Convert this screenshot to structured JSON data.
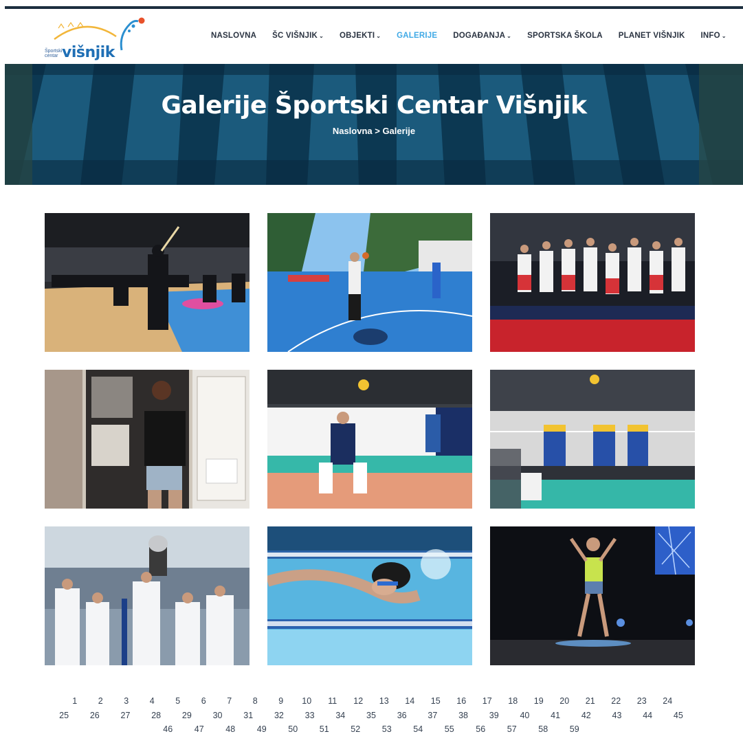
{
  "header": {
    "logo": {
      "small_text": "Športski centar",
      "name": "višnjik"
    },
    "nav": [
      {
        "label": "NASLOVNA",
        "dropdown": false,
        "active": false
      },
      {
        "label": "ŠC VIŠNJIK",
        "dropdown": true,
        "active": false
      },
      {
        "label": "OBJEKTI",
        "dropdown": true,
        "active": false
      },
      {
        "label": "GALERIJE",
        "dropdown": false,
        "active": true
      },
      {
        "label": "DOGAĐANJA",
        "dropdown": true,
        "active": false
      },
      {
        "label": "SPORTSKA ŠKOLA",
        "dropdown": false,
        "active": false
      },
      {
        "label": "PLANET VIŠNJIK",
        "dropdown": false,
        "active": false
      },
      {
        "label": "INFO",
        "dropdown": true,
        "active": false
      }
    ],
    "colors": {
      "accent": "#3fa9e6",
      "topbar": "#1c2e3f",
      "logo": "#1f6fb5"
    }
  },
  "hero": {
    "title": "Galerije Športski Centar Višnjik",
    "breadcrumb": "Naslovna > Galerije"
  },
  "gallery": [
    {
      "subject": "kendo-hall"
    },
    {
      "subject": "outdoor-basketball"
    },
    {
      "subject": "volleyball-team-celebration"
    },
    {
      "subject": "museum-visitor"
    },
    {
      "subject": "volleyball-player-receiving"
    },
    {
      "subject": "volleyball-block"
    },
    {
      "subject": "trophy-celebration"
    },
    {
      "subject": "swimmer"
    },
    {
      "subject": "stage-dancer"
    }
  ],
  "pagination": {
    "pages": [
      "1",
      "2",
      "3",
      "4",
      "5",
      "6",
      "7",
      "8",
      "9",
      "10",
      "11",
      "12",
      "13",
      "14",
      "15",
      "16",
      "17",
      "18",
      "19",
      "20",
      "21",
      "22",
      "23",
      "24",
      "25",
      "26",
      "27",
      "28",
      "29",
      "30",
      "31",
      "32",
      "33",
      "34",
      "35",
      "36",
      "37",
      "38",
      "39",
      "40",
      "41",
      "42",
      "43",
      "44",
      "45",
      "46",
      "47",
      "48",
      "49",
      "50",
      "51",
      "52",
      "53",
      "54",
      "55",
      "56",
      "57",
      "58",
      "59"
    ]
  }
}
